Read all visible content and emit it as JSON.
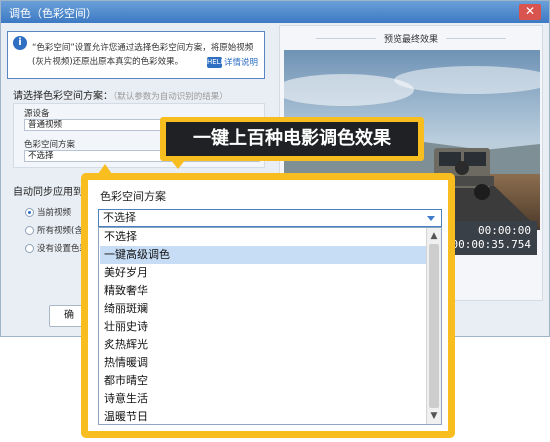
{
  "window": {
    "title": "调色（色彩空间）",
    "close_glyph": "✕"
  },
  "info": {
    "icon_glyph": "i",
    "text": "“色彩空间”设置允许您通过选择色彩空间方案，将原始视频(灰片视频)还原出原本真实的色彩效果。",
    "help_label": "详情说明",
    "help_icon_text": "HELP"
  },
  "scheme": {
    "label": "请选择色彩空间方案：",
    "hint": "（默认参数为自动识别的结果）",
    "source_device_label": "源设备",
    "source_device_value": "普通视频",
    "color_space_label": "色彩空间方案",
    "color_space_value": "不选择"
  },
  "sync": {
    "label": "自动同步应用到",
    "options": [
      {
        "label": "当前视频",
        "checked": true
      },
      {
        "label": "所有视频(含",
        "checked": false
      },
      {
        "label": "没有设置色彩",
        "checked": false
      }
    ],
    "partial_label": "自动"
  },
  "bottom_button_label": "确",
  "preview": {
    "title": "预览最终效果",
    "time_current": "00:00:00",
    "time_total": "00:00:35.754"
  },
  "callout": {
    "text": "一键上百种电影调色效果"
  },
  "popup": {
    "label": "色彩空间方案",
    "selected_value": "不选择",
    "options": [
      "不选择",
      "一键高级调色",
      "美好岁月",
      "精致奢华",
      "绮丽斑斓",
      "壮丽史诗",
      "炙热辉光",
      "热情暖调",
      "都市晴空",
      "诗意生活",
      "温暖节日"
    ],
    "highlighted_index": 1,
    "scroll_up_glyph": "▲",
    "scroll_down_glyph": "▼"
  },
  "colors": {
    "accent_yellow": "#f8bd1f",
    "selection_blue": "#c7ddf5",
    "title_blue": "#3d79c4"
  }
}
